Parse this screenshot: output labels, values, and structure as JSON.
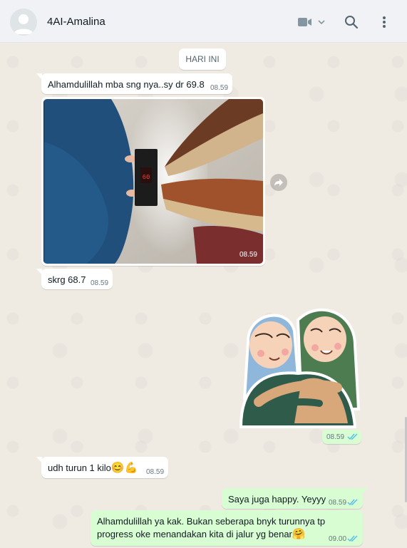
{
  "header": {
    "contact_name": "4AI-Amalina",
    "icons": [
      "avatar",
      "video-call-icon",
      "chevron-down-icon",
      "search-icon",
      "menu-icon"
    ]
  },
  "date_divider": "HARI INI",
  "messages": [
    {
      "direction": "in",
      "text": "Alhamdulillah mba sng nya..sy dr 69.8",
      "time": "08.59"
    },
    {
      "direction": "in",
      "type": "image",
      "time": "08.59"
    },
    {
      "direction": "in",
      "text": "skrg 68.7",
      "time": "08.59"
    },
    {
      "direction": "out",
      "type": "sticker",
      "time": "08.59",
      "status": "read"
    },
    {
      "direction": "in",
      "text": "udh turun 1 kilo",
      "emojis": [
        "😊",
        "💪"
      ],
      "time": "08.59"
    },
    {
      "direction": "out",
      "text": "Saya juga happy. Yeyyy",
      "time": "08.59",
      "status": "read"
    },
    {
      "direction": "out",
      "lines": [
        "Alhamdulillah ya kak. Bukan seberapa bnyk turunnya tp",
        "progress oke menandakan kita di jalur yg benar"
      ],
      "emojis": [
        "🤗"
      ],
      "time": "09.00",
      "status": "read"
    }
  ],
  "colors": {
    "chat_background": "#efeae2",
    "incoming_bubble": "#ffffff",
    "outgoing_bubble": "#d9fdd3",
    "read_ticks": "#53bdeb",
    "header": "#f0f2f5"
  }
}
